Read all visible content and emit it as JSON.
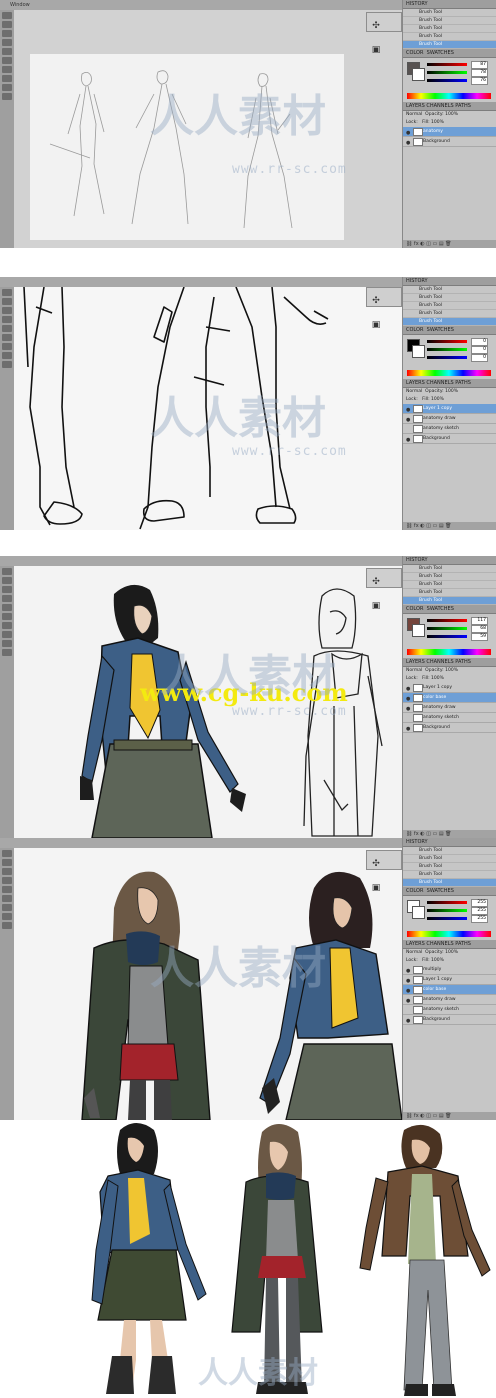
{
  "panels": [
    {
      "id": "step1",
      "menu": "Window",
      "history": [
        "Brush Tool",
        "Brush Tool",
        "Brush Tool",
        "Brush Tool",
        "Brush Tool"
      ],
      "history_selected": 4,
      "color_tab": "COLOR",
      "swatches_tab": "SWATCHES",
      "color_values": [
        "87",
        "78",
        "76"
      ],
      "layers_tabs": "LAYERS   CHANNELS   PATHS",
      "blend": "Normal",
      "opacity_label": "Opacity:",
      "opacity": "100%",
      "fill_label": "Fill:",
      "fill": "100%",
      "layers": [
        "anatomy",
        "Background"
      ],
      "layers_selected": 0
    },
    {
      "id": "step2",
      "history": [
        "Brush Tool",
        "Brush Tool",
        "Brush Tool",
        "Brush Tool",
        "Brush Tool"
      ],
      "history_selected": 4,
      "color_tab": "COLOR",
      "swatches_tab": "SWATCHES",
      "color_values": [
        "0",
        "0",
        "0"
      ],
      "layers_tabs": "LAYERS   CHANNELS   PATHS",
      "blend": "Normal",
      "opacity_label": "Opacity:",
      "opacity": "100%",
      "fill_label": "Fill:",
      "fill": "100%",
      "layers": [
        "Layer 1 copy",
        "anatomy draw",
        "anatomy sketch",
        "Background"
      ],
      "layers_selected": 0
    },
    {
      "id": "step3",
      "history": [
        "Brush Tool",
        "Brush Tool",
        "Brush Tool",
        "Brush Tool",
        "Brush Tool"
      ],
      "history_selected": 4,
      "color_tab": "COLOR",
      "swatches_tab": "SWATCHES",
      "color_values": [
        "117",
        "68",
        "59"
      ],
      "layers_tabs": "LAYERS   CHANNELS   PATHS",
      "blend": "Normal",
      "opacity_label": "Opacity:",
      "opacity": "100%",
      "fill_label": "Fill:",
      "fill": "100%",
      "layers": [
        "Layer 1 copy",
        "color base",
        "anatomy draw",
        "anatomy sketch",
        "Background"
      ],
      "layers_selected": 1
    },
    {
      "id": "step4",
      "history": [
        "Brush Tool",
        "Brush Tool",
        "Brush Tool",
        "Brush Tool",
        "Brush Tool"
      ],
      "history_selected": 4,
      "color_tab": "COLOR",
      "swatches_tab": "SWATCHES",
      "color_values": [
        "255",
        "255",
        "255"
      ],
      "layers_tabs": "LAYERS   CHANNELS   PATHS",
      "blend": "Normal",
      "opacity_label": "Opacity:",
      "opacity": "100%",
      "fill_label": "Fill:",
      "fill": "100%",
      "layers": [
        "multiply",
        "Layer 1 copy",
        "color base",
        "anatomy draw",
        "anatomy sketch",
        "Background"
      ],
      "layers_selected": 2
    }
  ],
  "watermark": {
    "brand": "人人素材",
    "url": "www.rr-sc.com"
  },
  "overlay_url": "www.cg-ku.com",
  "colors": {
    "denim": "#3d5f86",
    "yellow": "#f0c531",
    "skirt": "#5d6558",
    "coat": "#3b4739",
    "scarf": "#233a57",
    "red": "#a3232b",
    "leather": "#6d4e36",
    "tank": "#a6b48c",
    "jeans": "#8e9398"
  }
}
